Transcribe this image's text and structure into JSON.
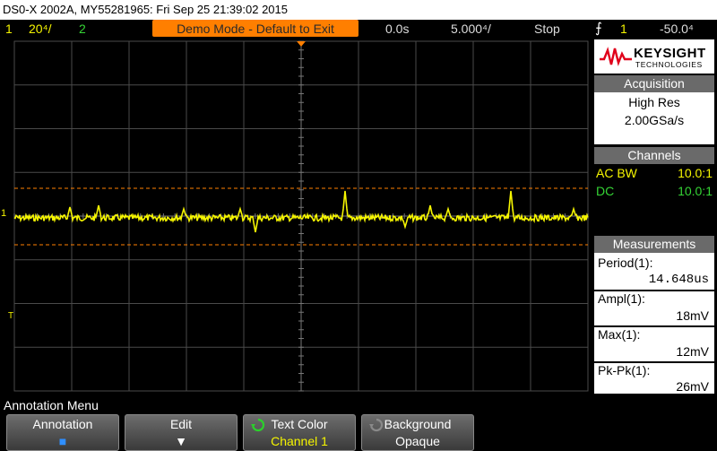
{
  "title": "DS0-X 2002A, MY55281965: Fri Sep 25 21:39:02 2015",
  "status": {
    "ch1_num": "1",
    "ch1_scale": "20⁴/",
    "ch2_num": "2",
    "banner": "Demo Mode - Default to Exit",
    "delay": "0.0s",
    "timebase": "5.000⁴/",
    "run_state": "Stop",
    "trigger_icon": "⨍",
    "trigger_source": "1",
    "trigger_level": "-50.0⁴"
  },
  "logo": {
    "brand": "KEYSIGHT",
    "sub": "TECHNOLOGIES"
  },
  "acquisition": {
    "header": "Acquisition",
    "mode": "High Res",
    "rate": "2.00GSa/s"
  },
  "channels": {
    "header": "Channels",
    "items": [
      {
        "left": "AC BW",
        "right": "10.0:1",
        "color": "#f5f500"
      },
      {
        "left": "DC",
        "right": "10.0:1",
        "color": "#35d435"
      }
    ]
  },
  "measurements": {
    "header": "Measurements",
    "items": [
      {
        "label": "Period(1):",
        "value": "14.648us"
      },
      {
        "label": "Ampl(1):",
        "value": "18mV"
      },
      {
        "label": "Max(1):",
        "value": "12mV"
      },
      {
        "label": "Pk-Pk(1):",
        "value": "26mV"
      }
    ]
  },
  "display": {
    "ch1_marker": "1",
    "trigger_marker": "T",
    "trace_color": "#f5f500",
    "cursor_color": "#ff7f00",
    "grid_color": "#4a4a4a"
  },
  "menu": {
    "title": "Annotation Menu",
    "softkeys": [
      {
        "top": "Annotation",
        "bottom": "■"
      },
      {
        "top": "Edit",
        "bottom": "▼"
      },
      {
        "top": "Text Color",
        "bottom": "Channel 1"
      },
      {
        "top": "Background",
        "bottom": "Opaque"
      }
    ]
  }
}
